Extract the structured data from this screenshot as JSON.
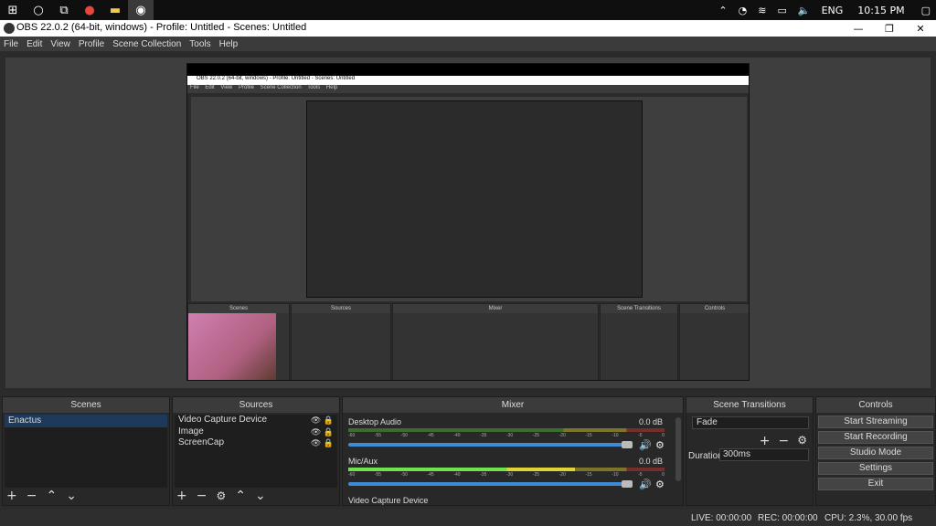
{
  "taskbar": {
    "language": "ENG",
    "time": "10:15 PM"
  },
  "window": {
    "title": "OBS 22.0.2 (64-bit, windows) - Profile: Untitled - Scenes: Untitled"
  },
  "menu": [
    "File",
    "Edit",
    "View",
    "Profile",
    "Scene Collection",
    "Tools",
    "Help"
  ],
  "preview": {
    "title": "OBS 22.0.2 (64-bit, windows) - Profile: Untitled - Scenes: Untitled",
    "menu": [
      "File",
      "Edit",
      "View",
      "Profile",
      "Scene Collection",
      "Tools",
      "Help"
    ],
    "dock_titles": [
      "Scenes",
      "Sources",
      "Mixer",
      "Scene Transitions",
      "Controls"
    ]
  },
  "scenes": {
    "title": "Scenes",
    "items": [
      "Enactus"
    ]
  },
  "sources": {
    "title": "Sources",
    "items": [
      "Video Capture Device",
      "Image",
      "ScreenCap"
    ]
  },
  "mixer": {
    "title": "Mixer",
    "channels": [
      {
        "name": "Desktop Audio",
        "db": "0.0 dB",
        "level": 0
      },
      {
        "name": "Mic/Aux",
        "db": "0.0 dB",
        "level": 0.72
      },
      {
        "name": "Video Capture Device",
        "db": "",
        "level": 0
      }
    ],
    "ticks": [
      "-60",
      "-55",
      "-50",
      "-45",
      "-40",
      "-35",
      "-30",
      "-25",
      "-20",
      "-15",
      "-10",
      "-5",
      "0"
    ]
  },
  "transitions": {
    "title": "Scene Transitions",
    "selected": "Fade",
    "duration_label": "Duration",
    "duration_value": "300ms"
  },
  "controls": {
    "title": "Controls",
    "buttons": [
      "Start Streaming",
      "Start Recording",
      "Studio Mode",
      "Settings",
      "Exit"
    ]
  },
  "status": {
    "live": "LIVE: 00:00:00",
    "rec": "REC: 00:00:00",
    "cpu": "CPU: 2.3%, 30.00 fps"
  }
}
